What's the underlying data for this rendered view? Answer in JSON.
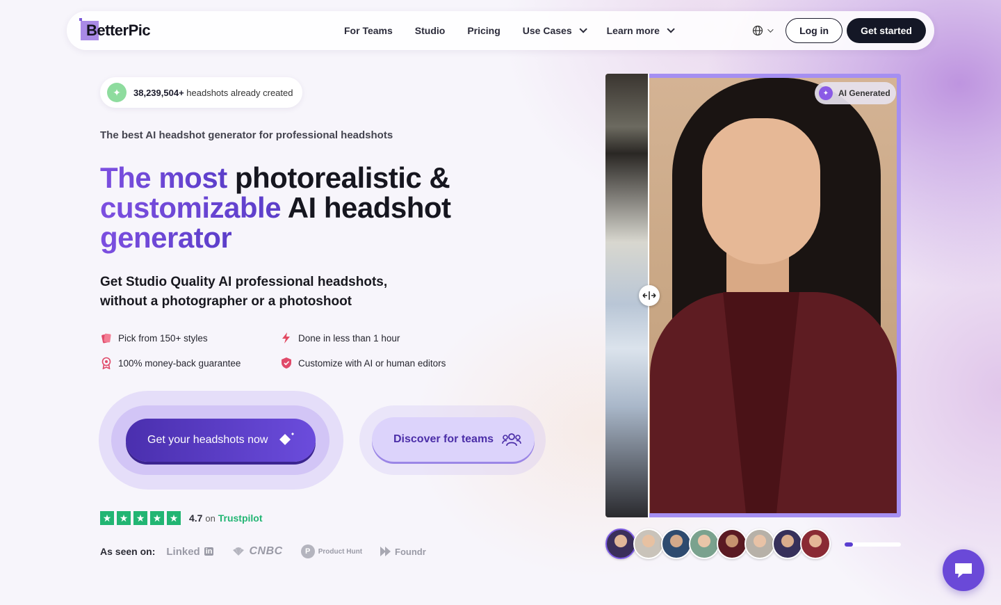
{
  "nav": {
    "logo": "BetterPic",
    "links": [
      {
        "label": "For Teams"
      },
      {
        "label": "Studio"
      },
      {
        "label": "Pricing"
      },
      {
        "label": "Use Cases"
      },
      {
        "label": "Learn more"
      }
    ],
    "login": "Log in",
    "get_started": "Get started"
  },
  "hero": {
    "counter_number": "38,239,504+",
    "counter_text": " headshots already created",
    "tagline": "The best AI headshot generator for professional headshots",
    "headline_a": "The most",
    "headline_b": " photorealistic &",
    "headline_c": "customizable",
    "headline_d": " AI headshot",
    "headline_e": "generator",
    "subhead": "Get Studio Quality AI professional headshots, without a photographer or a photoshoot",
    "features": [
      {
        "label": "Pick from 150+ styles",
        "icon": "styles-icon"
      },
      {
        "label": "Done in less than 1 hour",
        "icon": "lightning-icon"
      },
      {
        "label": "100% money-back guarantee",
        "icon": "badge-icon"
      },
      {
        "label": "Customize with AI or human editors",
        "icon": "shield-icon"
      }
    ],
    "cta_primary": "Get your headshots now",
    "cta_teams": "Discover for teams"
  },
  "trust": {
    "rating": "4.7",
    "on": "on",
    "brand": "Trustpilot",
    "stars": 5
  },
  "seen_on": {
    "label": "As seen on:",
    "outlets": [
      "Linked",
      "in",
      "CNBC",
      "Product Hunt",
      "Foundr"
    ]
  },
  "preview": {
    "badge": "AI Generated",
    "thumbnail_count": 8,
    "progress": 0.15
  },
  "colors": {
    "accent": "#6b4cdc",
    "dark": "#141726",
    "trustpilot": "#22b573"
  }
}
